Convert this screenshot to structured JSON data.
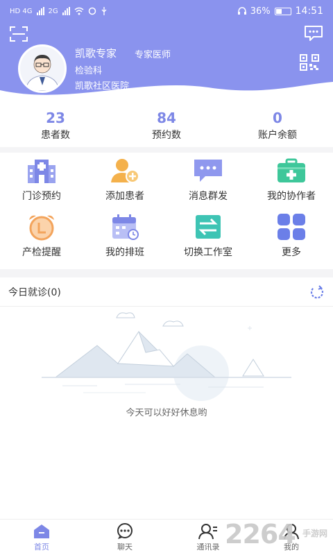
{
  "status_bar": {
    "network_left": "HD 4G",
    "network_right": "2G",
    "battery": "36%",
    "time": "14:51"
  },
  "header": {
    "doctor_name": "凯歌专家",
    "doctor_title": "专家医师",
    "department": "检验科",
    "hospital": "凯歌社区医院",
    "icons": [
      "scan-icon",
      "message-icon",
      "qr-code-icon"
    ]
  },
  "stats": [
    {
      "value": "23",
      "label": "患者数"
    },
    {
      "value": "84",
      "label": "预约数"
    },
    {
      "value": "0",
      "label": "账户余额"
    }
  ],
  "functions": [
    {
      "label": "门诊预约",
      "icon": "hospital-icon",
      "color": "#7d87e6"
    },
    {
      "label": "添加患者",
      "icon": "add-patient-icon",
      "color": "#f4b14c"
    },
    {
      "label": "消息群发",
      "icon": "broadcast-message-icon",
      "color": "#7d87e6"
    },
    {
      "label": "我的协作者",
      "icon": "medical-kit-icon",
      "color": "#3ec79a"
    },
    {
      "label": "产检提醒",
      "icon": "alarm-clock-icon",
      "color": "#f3a45c"
    },
    {
      "label": "我的排班",
      "icon": "calendar-icon",
      "color": "#7d87e6"
    },
    {
      "label": "切换工作室",
      "icon": "switch-icon",
      "color": "#3ec4b4"
    },
    {
      "label": "更多",
      "icon": "more-grid-icon",
      "color": "#6b7fe8"
    }
  ],
  "today": {
    "title": "今日就诊(0)",
    "empty_text": "今天可以好好休息哟"
  },
  "nav": [
    {
      "label": "首页",
      "icon": "home-icon",
      "active": true
    },
    {
      "label": "聊天",
      "icon": "chat-icon",
      "active": false
    },
    {
      "label": "通讯录",
      "icon": "contacts-icon",
      "active": false
    },
    {
      "label": "我的",
      "icon": "profile-icon",
      "active": false
    }
  ],
  "watermark": {
    "big": "2264",
    "small": "手游网"
  },
  "colors": {
    "primary": "#8a93ee",
    "accent": "#7d87e6"
  }
}
